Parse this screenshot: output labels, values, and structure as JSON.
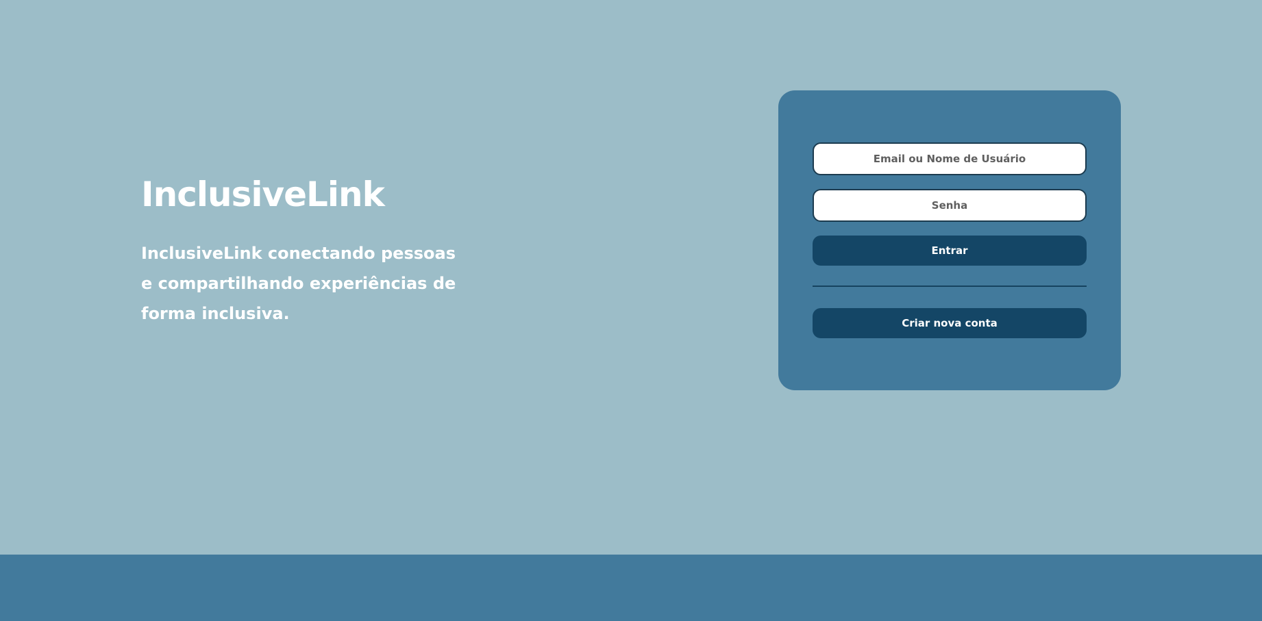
{
  "brand": {
    "title": "InclusiveLink",
    "tagline": "InclusiveLink conectando pessoas e compartilhando experiências de forma inclusiva."
  },
  "login_form": {
    "email_placeholder": "Email ou Nome de Usuário",
    "email_value": "",
    "password_placeholder": "Senha",
    "password_value": "",
    "login_label": "Entrar",
    "create_account_label": "Criar nova conta"
  },
  "colors": {
    "background": "#9cbdc8",
    "card": "#427a9c",
    "button": "#144666",
    "footer": "#427a9c",
    "text_light": "#ffffff"
  }
}
